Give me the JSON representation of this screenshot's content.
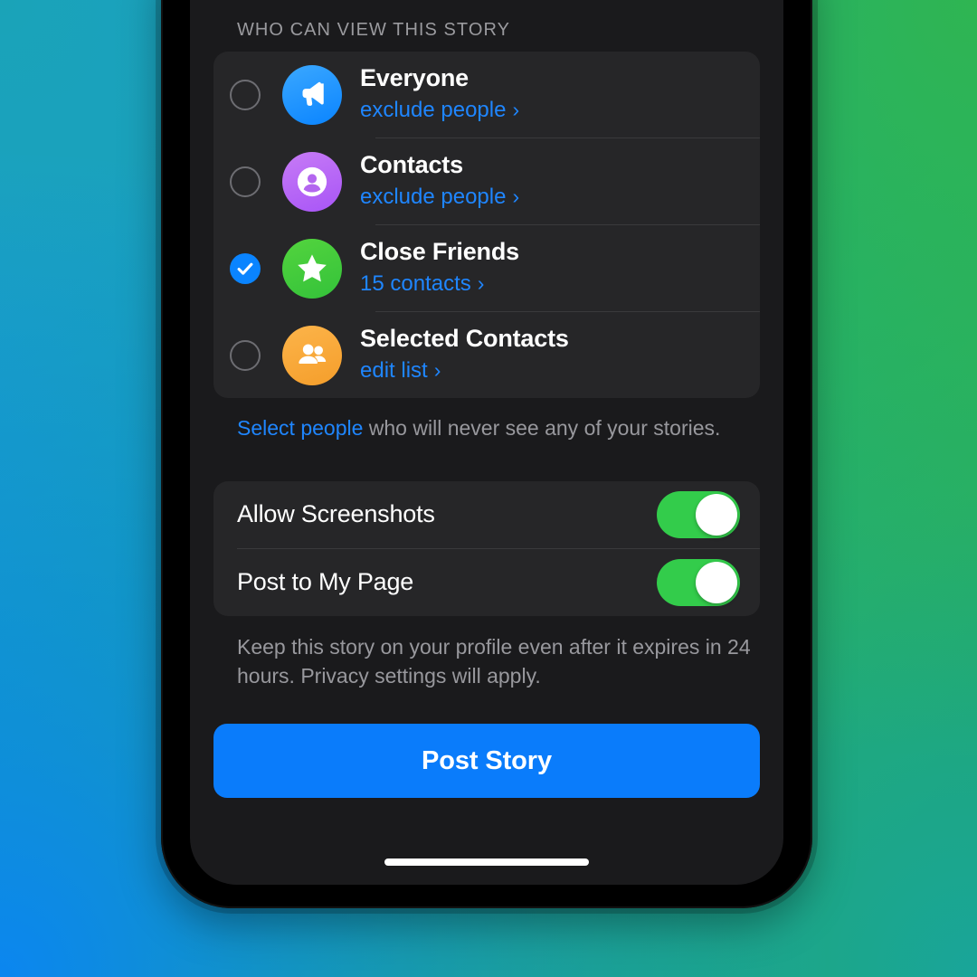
{
  "screen": {
    "section_header": "WHO CAN VIEW THIS STORY",
    "audience": {
      "options": [
        {
          "title": "Everyone",
          "sub": "exclude people",
          "chevron": "›",
          "selected": false,
          "icon": "megaphone-icon",
          "icon_color": "#0a84ff"
        },
        {
          "title": "Contacts",
          "sub": "exclude people",
          "chevron": "›",
          "selected": false,
          "icon": "person-circle-icon",
          "icon_color": "#a855f7"
        },
        {
          "title": "Close Friends",
          "sub": "15 contacts",
          "chevron": "›",
          "selected": true,
          "icon": "star-icon",
          "icon_color": "#34c23a"
        },
        {
          "title": "Selected Contacts",
          "sub": "edit list",
          "chevron": "›",
          "selected": false,
          "icon": "group-people-icon",
          "icon_color": "#f59e2b"
        }
      ]
    },
    "audience_footnote": {
      "link": "Select people",
      "rest": " who will never see any of your stories."
    },
    "toggles": [
      {
        "label": "Allow Screenshots",
        "on": true
      },
      {
        "label": "Post to My Page",
        "on": true
      }
    ],
    "toggles_footnote": "Keep this story on your profile even after it expires in 24 hours. Privacy settings will apply.",
    "post_button": "Post Story"
  },
  "colors": {
    "accent_blue": "#0a84ff",
    "button_blue": "#0a7cfb",
    "toggle_green": "#33cc4b",
    "card_bg": "#262628",
    "screen_bg": "#1a1a1c",
    "link_blue": "#1f86ff",
    "muted_text": "#98989d"
  }
}
